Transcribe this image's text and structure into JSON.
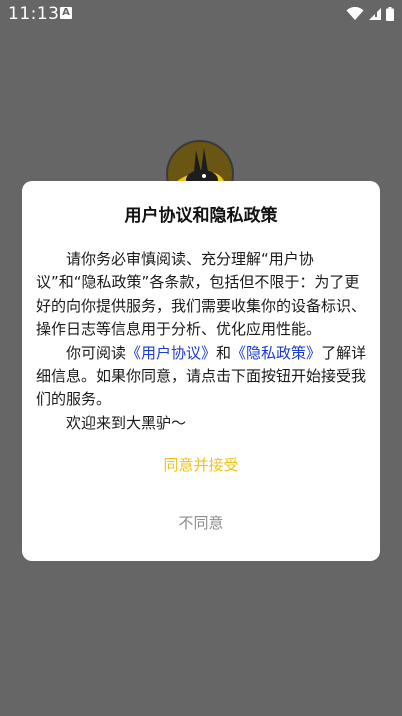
{
  "status_bar": {
    "time": "11:13",
    "notification_icon_letter": "A",
    "icons": [
      "wifi-icon",
      "signal-icon",
      "battery-icon"
    ]
  },
  "dialog": {
    "title": "用户协议和隐私政策",
    "paragraph1": "请你务必审慎阅读、充分理解“用户协议”和“隐私政策”各条款，包括但不限于：为了更好的向你提供服务，我们需要收集你的设备标识、操作日志等信息用于分析、优化应用性能。",
    "paragraph2_prefix": "你可阅读",
    "user_agreement_link": "《用户协议》",
    "paragraph2_and": "和",
    "privacy_policy_link": "《隐私政策》",
    "paragraph2_suffix": "了解详细信息。如果你同意，请点击下面按钮开始接受我们的服务。",
    "paragraph3": "欢迎来到大黑驴～",
    "agree_label": "同意并接受",
    "disagree_label": "不同意"
  },
  "colors": {
    "overlay": "#666666",
    "agree": "#f2c21a",
    "link": "#1a3bd6",
    "disagree": "#8c8c8c"
  }
}
